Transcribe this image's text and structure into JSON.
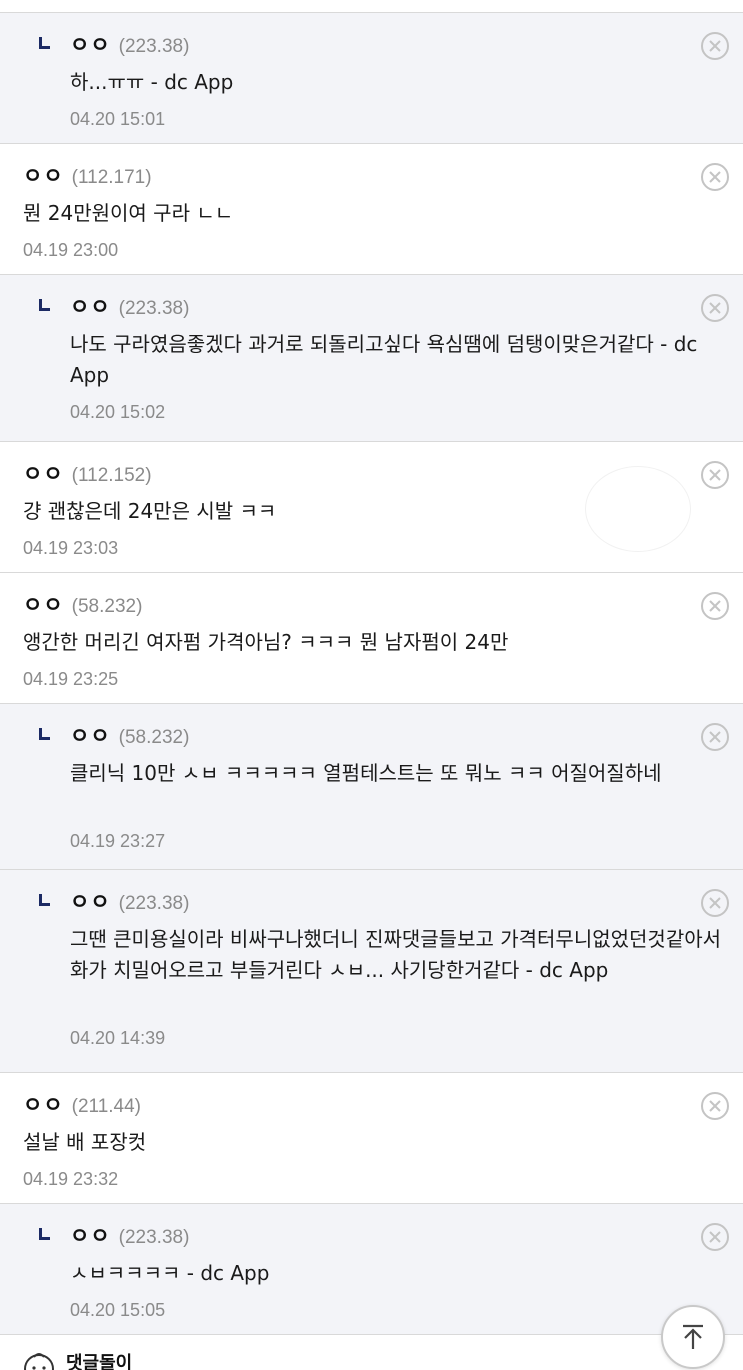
{
  "comments": [
    {
      "reply": true,
      "nick": "ㅇㅇ",
      "ip": "(223.38)",
      "text": "하...ㅠㅠ - dc App",
      "date": "04.20 15:01"
    },
    {
      "reply": false,
      "nick": "ㅇㅇ",
      "ip": "(112.171)",
      "text": "뭔 24만원이여 구라 ㄴㄴ",
      "date": "04.19 23:00"
    },
    {
      "reply": true,
      "nick": "ㅇㅇ",
      "ip": "(223.38)",
      "text": "나도 구라였음좋겠다 과거로 되돌리고싶다 욕심땜에 덤탱이맞은거같다 - dc App",
      "date": "04.20 15:02"
    },
    {
      "reply": false,
      "nick": "ㅇㅇ",
      "ip": "(112.152)",
      "text": "걍 괜찮은데 24만은 시발 ㅋㅋ",
      "date": "04.19 23:03"
    },
    {
      "reply": false,
      "nick": "ㅇㅇ",
      "ip": "(58.232)",
      "text": "앵간한 머리긴 여자펌 가격아님? ㅋㅋㅋ 뭔 남자펌이 24만",
      "date": "04.19 23:25"
    },
    {
      "reply": true,
      "nick": "ㅇㅇ",
      "ip": "(58.232)",
      "text": "클리닉 10만 ㅅㅂ ㅋㅋㅋㅋㅋ 열펌테스트는 또 뭐노 ㅋㅋ 어질어질하네",
      "date": "04.19 23:27"
    },
    {
      "reply": true,
      "nick": "ㅇㅇ",
      "ip": "(223.38)",
      "text": "그땐 큰미용실이라 비싸구나했더니 진짜댓글들보고 가격터무니없었던것같아서 화가 치밀어오르고 부들거린다 ㅅㅂ... 사기당한거같다 - dc App",
      "date": "04.20 14:39"
    },
    {
      "reply": false,
      "nick": "ㅇㅇ",
      "ip": "(211.44)",
      "text": "설날 배 포장컷",
      "date": "04.19 23:32"
    },
    {
      "reply": true,
      "nick": "ㅇㅇ",
      "ip": "(223.38)",
      "text": "ㅅㅂㅋㅋㅋㅋ - dc App",
      "date": "04.20 15:05"
    }
  ],
  "footer": {
    "label": "댓글돌이",
    "icon": "dol-mascot-icon"
  },
  "top_button": {
    "icon": "arrow-up-icon"
  },
  "colors": {
    "reply_bg": "#f3f4f8",
    "marker": "#1c2a64",
    "muted": "#8a8a8a"
  }
}
